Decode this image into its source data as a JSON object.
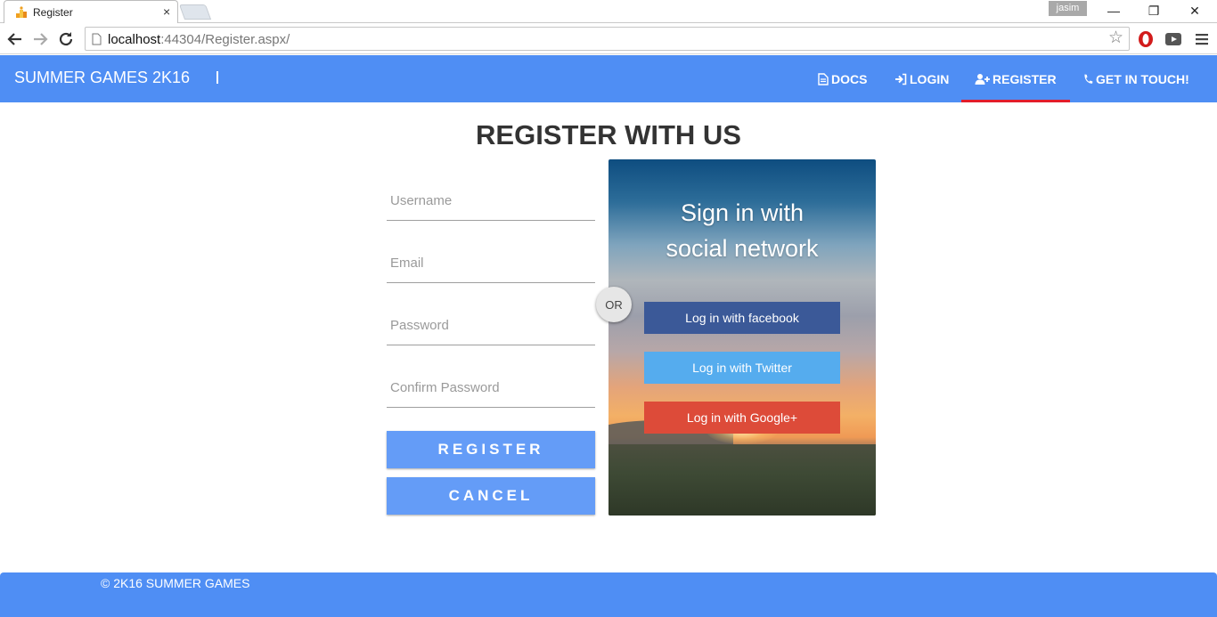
{
  "browser": {
    "tab_title": "Register",
    "tab_close": "×",
    "user": "jasim",
    "win_minimize": "—",
    "win_restore": "❐",
    "win_close": "✕",
    "url_host": "localhost",
    "url_rest": ":44304/Register.aspx/",
    "bookmark_star": "☆"
  },
  "header": {
    "brand": "SUMMER GAMES 2K16",
    "nav": [
      {
        "label": "DOCS",
        "icon": "file-icon"
      },
      {
        "label": "LOGIN",
        "icon": "sign-in-icon"
      },
      {
        "label": "REGISTER",
        "icon": "user-plus-icon",
        "active": true
      },
      {
        "label": "GET IN TOUCH!",
        "icon": "phone-icon"
      }
    ],
    "colors": {
      "bar": "#4f8ef4",
      "active_underline": "#e21d2b"
    }
  },
  "main": {
    "title": "REGISTER WITH US",
    "fields": [
      {
        "placeholder": "Username",
        "value": ""
      },
      {
        "placeholder": "Email",
        "value": ""
      },
      {
        "placeholder": "Password",
        "value": ""
      },
      {
        "placeholder": "Confirm Password",
        "value": ""
      }
    ],
    "register_label": "REGISTER",
    "cancel_label": "CANCEL",
    "or_label": "OR"
  },
  "social": {
    "title_line1": "Sign in with",
    "title_line2": "social network",
    "facebook_label": "Log in with facebook",
    "twitter_label": "Log in with Twitter",
    "google_label": "Log in with Google+",
    "colors": {
      "facebook": "#3b5998",
      "twitter": "#55acee",
      "google": "#dd4b39"
    }
  },
  "footer": {
    "text": "© 2K16 SUMMER GAMES"
  }
}
